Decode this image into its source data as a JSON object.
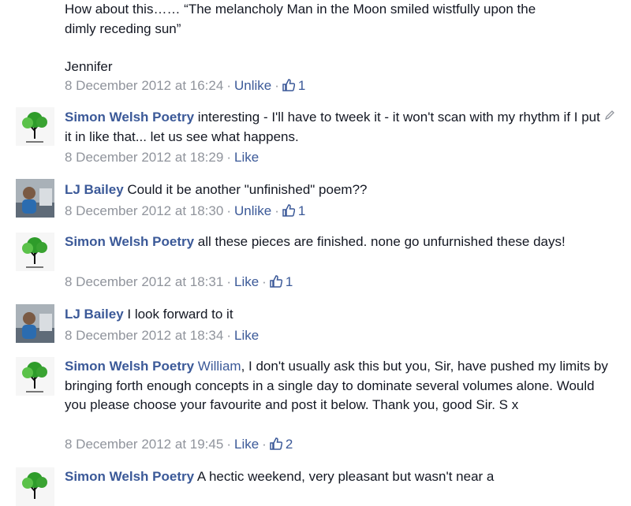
{
  "comments": [
    {
      "text_line1": "How about this…… “The melancholy Man in the Moon smiled wistfully upon the",
      "text_line2": "dimly receding sun”",
      "signature": "Jennifer",
      "timestamp": "8 December 2012 at 16:24",
      "action": "Unlike",
      "likes": "1"
    },
    {
      "author": "Simon Welsh Poetry",
      "text": " interesting - I'll have to tweek it - it won't scan with my rhythm if I put it in like that... let us see what happens.",
      "timestamp": "8 December 2012 at 18:29",
      "action": "Like"
    },
    {
      "author": "LJ Bailey",
      "text": " Could it be another \"unfinished\" poem??",
      "timestamp": "8 December 2012 at 18:30",
      "action": "Unlike",
      "likes": "1"
    },
    {
      "author": "Simon Welsh Poetry",
      "text": " all these pieces are finished. none go unfurnished these days!",
      "timestamp": "8 December 2012 at 18:31",
      "action": "Like",
      "likes": "1"
    },
    {
      "author": "LJ Bailey",
      "text": " I look forward to it",
      "timestamp": "8 December 2012 at 18:34",
      "action": "Like"
    },
    {
      "author": "Simon Welsh Poetry",
      "mention": "William",
      "text": ", I don't usually ask this but you, Sir, have pushed my limits by bringing forth enough concepts in a single day to dominate several volumes alone. Would you please choose your favourite and post it below. Thank you, good Sir. S x",
      "timestamp": "8 December 2012 at 19:45",
      "action": "Like",
      "likes": "2"
    },
    {
      "author": "Simon Welsh Poetry",
      "text": " A hectic weekend, very pleasant but wasn't near a"
    }
  ],
  "colors": {
    "link": "#3b5998",
    "meta": "#90949c",
    "text": "#141823"
  },
  "icons": {
    "like": "thumbs-up-icon",
    "edit": "pencil-icon"
  }
}
